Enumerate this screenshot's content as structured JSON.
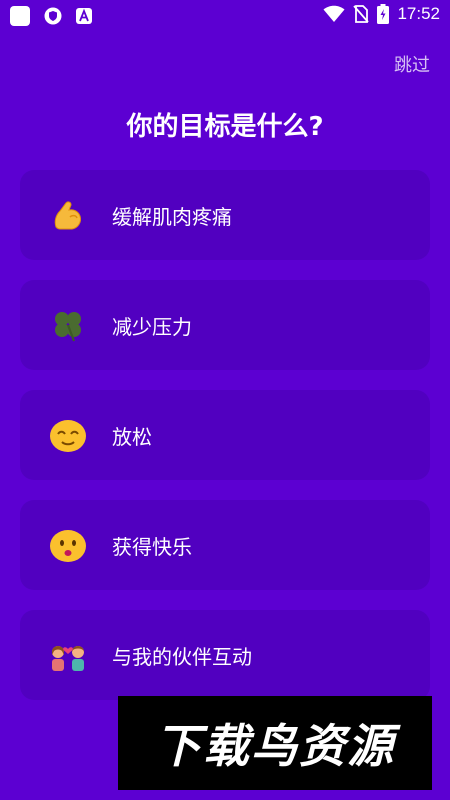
{
  "status_bar": {
    "time": "17:52",
    "left_icons": [
      "app-notification-icon",
      "shield-icon",
      "letter-a-icon"
    ],
    "right_icons": [
      "wifi-icon",
      "no-sim-icon",
      "battery-charging-icon"
    ]
  },
  "header": {
    "skip_label": "跳过",
    "title": "你的目标是什么?"
  },
  "options": [
    {
      "label": "缓解肌肉疼痛",
      "icon": "flexed-biceps-icon"
    },
    {
      "label": "减少压力",
      "icon": "four-leaf-clover-icon"
    },
    {
      "label": "放松",
      "icon": "relieved-face-icon"
    },
    {
      "label": "获得快乐",
      "icon": "face-icon"
    },
    {
      "label": "与我的伙伴互动",
      "icon": "couple-with-heart-icon"
    }
  ],
  "watermark": {
    "text": "下载鸟资源"
  },
  "colors": {
    "background": "#5c00d2",
    "card": "#5100c0",
    "text": "#ffffff"
  }
}
